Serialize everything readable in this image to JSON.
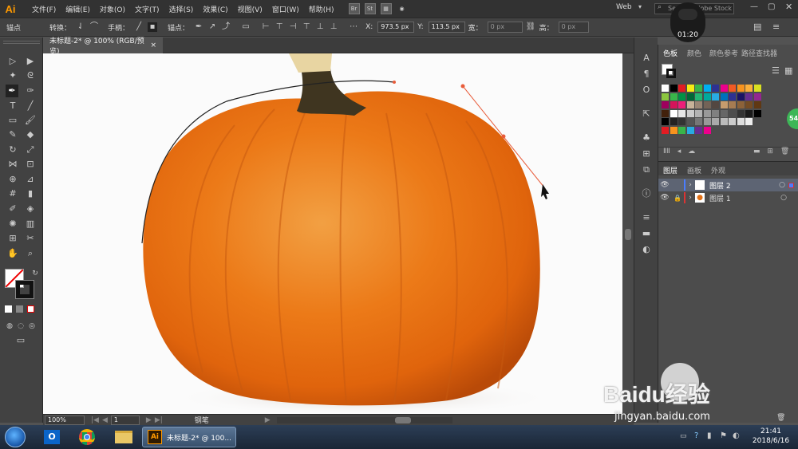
{
  "app": {
    "logo": "Ai"
  },
  "menu": [
    "文件(F)",
    "编辑(E)",
    "对象(O)",
    "文字(T)",
    "选择(S)",
    "效果(C)",
    "视图(V)",
    "窗口(W)",
    "帮助(H)"
  ],
  "menu_extras": {
    "br": "Br",
    "st": "St"
  },
  "workspace": {
    "label": "Web",
    "search_placeholder": "Search Adobe Stock"
  },
  "control": {
    "tool_label": "锚点",
    "convert_label": "转换：",
    "handle_label": "手柄：",
    "anchor_label": "锚点：",
    "x_label": "X:",
    "x_value": "973.5 px",
    "y_label": "Y:",
    "y_value": "113.5 px",
    "w_label": "宽：",
    "w_value": "0 px",
    "h_label": "高：",
    "h_value": "0 px"
  },
  "document": {
    "tab_title": "未标题-2* @ 100% (RGB/预览)",
    "close": "×"
  },
  "status": {
    "zoom": "100%",
    "artboard": "1",
    "tool": "钢笔"
  },
  "swatches_panel": {
    "tabs": [
      "色板",
      "颜色",
      "颜色参考",
      "路径查找器"
    ]
  },
  "layers_panel": {
    "tabs": [
      "图层",
      "画板",
      "外观"
    ],
    "layers": [
      {
        "name": "图层 2",
        "color": "#4a7dff"
      },
      {
        "name": "图层 1",
        "color": "#d33"
      }
    ]
  },
  "timer": "01:20",
  "badge": "54",
  "taskbar": {
    "ai_task_title": "未标题-2* @ 100...",
    "time": "21:41",
    "date": "2018/6/16"
  },
  "watermark": {
    "brand": "Baidu经验",
    "url": "jingyan.baidu.com"
  },
  "colors": {
    "accent": "#ff9a00",
    "path": "#e85c3a",
    "bg": "#535353"
  }
}
